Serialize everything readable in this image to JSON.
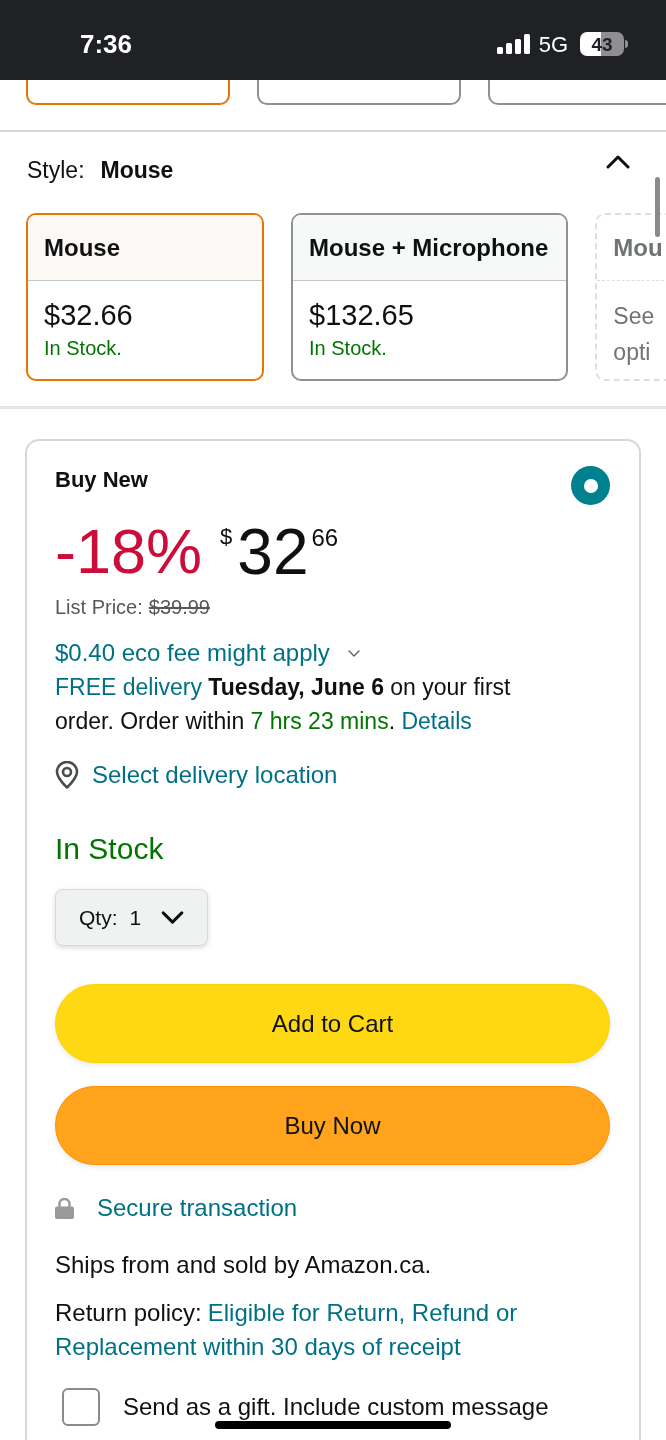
{
  "status_bar": {
    "time": "7:36",
    "network": "5G",
    "battery": "43"
  },
  "color_options": [
    {
      "selected": true
    },
    {
      "selected": false
    },
    {
      "selected": false
    }
  ],
  "style": {
    "label": "Style:",
    "value": "Mouse",
    "expanded": true
  },
  "style_options": [
    {
      "kind": "option",
      "name": "Mouse",
      "price": "$32.66",
      "availability": "In Stock.",
      "selected": true
    },
    {
      "kind": "option",
      "name": "Mouse + Microphone",
      "price": "$132.65",
      "availability": "In Stock.",
      "selected": false
    },
    {
      "kind": "see_options",
      "name": "Mou",
      "lines": [
        "See",
        "opti"
      ],
      "selected": false
    }
  ],
  "offer": {
    "title": "Buy New",
    "selected": true,
    "discount": "-18%",
    "price": {
      "currency": "$",
      "whole": "32",
      "fraction": "66"
    },
    "list_price": {
      "label": "List Price:",
      "value": "$39.99"
    },
    "eco_fee": "$0.40 eco fee might apply",
    "delivery": [
      {
        "kind": "link",
        "text": "FREE delivery"
      },
      {
        "kind": "bold",
        "text": " Tuesday, June 6"
      },
      {
        "kind": "plain",
        "text": " on your first order. Order within "
      },
      {
        "kind": "highlight",
        "text": "7 hrs 23 mins"
      },
      {
        "kind": "plain",
        "text": ". "
      },
      {
        "kind": "link",
        "text": "Details"
      }
    ],
    "location": "Select delivery location",
    "availability": "In Stock",
    "quantity": {
      "label": "Qty:",
      "value": "1"
    },
    "buttons": [
      {
        "kind": "add_to_cart",
        "label": "Add to Cart"
      },
      {
        "kind": "buy_now",
        "label": "Buy Now"
      }
    ],
    "secure": "Secure transaction",
    "seller": "Ships from and sold by Amazon.ca.",
    "return_policy": {
      "label": "Return policy:",
      "link_lines": [
        "Eligible for Return, Refund or",
        "Replacement within 30 days of receipt"
      ]
    },
    "gift": {
      "label": "Send as a gift. Include custom message",
      "checked": false
    }
  }
}
